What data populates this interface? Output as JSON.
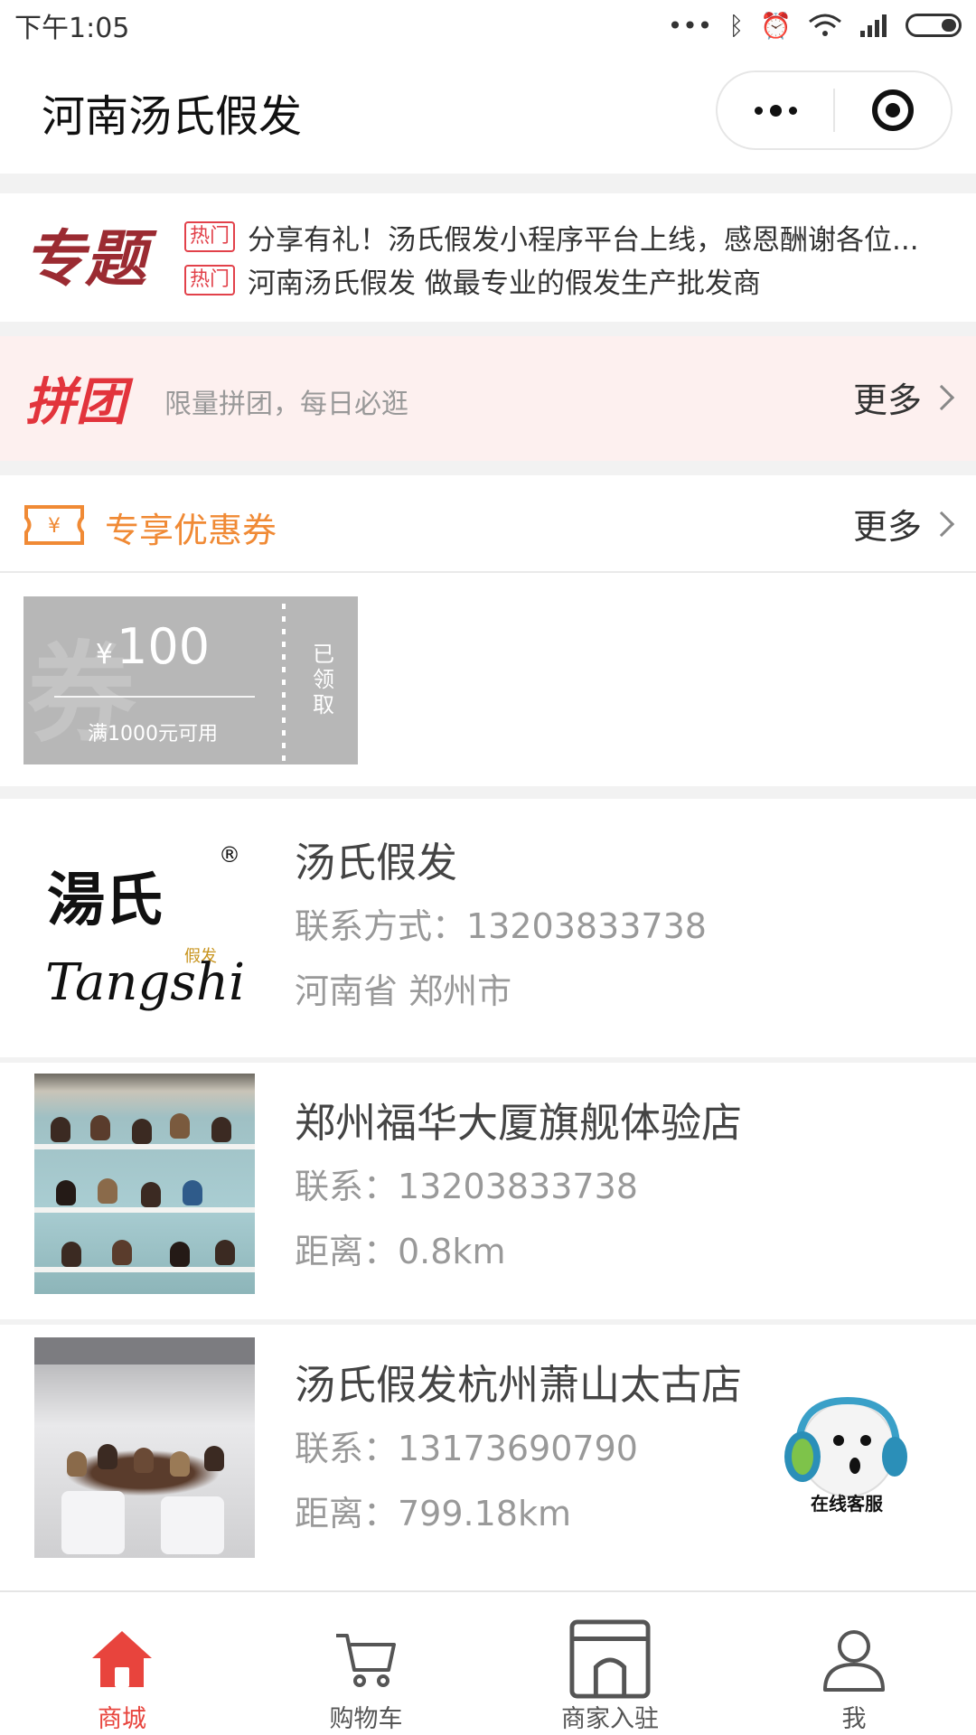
{
  "status_bar": {
    "time": "下午1:05"
  },
  "nav": {
    "title": "河南汤氏假发"
  },
  "topic": {
    "logo_text": "专题",
    "items": [
      {
        "badge": "热门",
        "text": "分享有礼！汤氏假发小程序平台上线，感恩酬谢各位..."
      },
      {
        "badge": "热门",
        "text": "河南汤氏假发 做最专业的假发生产批发商"
      }
    ]
  },
  "group_buy": {
    "logo_text": "拼团",
    "subtitle": "限量拼团，每日必逛",
    "more": "更多"
  },
  "coupons": {
    "title": "专享优惠券",
    "more": "更多",
    "icon_symbol": "¥",
    "items": [
      {
        "currency": "¥",
        "amount": "100",
        "condition": "满1000元可用",
        "status": "已领取",
        "watermark": "券"
      }
    ]
  },
  "brand": {
    "name": "汤氏假发",
    "contact": "联系方式：13203833738",
    "address": "河南省 郑州市",
    "logo_cn": "湯氏",
    "logo_en": "Tangshi",
    "logo_tag": "假发",
    "logo_reg": "®"
  },
  "stores": [
    {
      "name": "郑州福华大厦旗舰体验店",
      "contact": "联系：13203833738",
      "distance": "距离：0.8km"
    },
    {
      "name": "汤氏假发杭州萧山太古店",
      "contact": "联系：13173690790",
      "distance": "距离：799.18km"
    }
  ],
  "service": {
    "label": "在线客服"
  },
  "tabs": [
    {
      "label": "商城",
      "icon": "home-icon",
      "active": true
    },
    {
      "label": "购物车",
      "icon": "cart-icon",
      "active": false
    },
    {
      "label": "商家入驻",
      "icon": "storefront-icon",
      "active": false
    },
    {
      "label": "我",
      "icon": "user-icon",
      "active": false
    }
  ],
  "colors": {
    "accent": "#e8443d",
    "coupon_orange": "#f08a35",
    "coupon_gray": "#b7b7b7",
    "group_bg": "#fdf0ef",
    "topic_red": "#9b2b32"
  }
}
